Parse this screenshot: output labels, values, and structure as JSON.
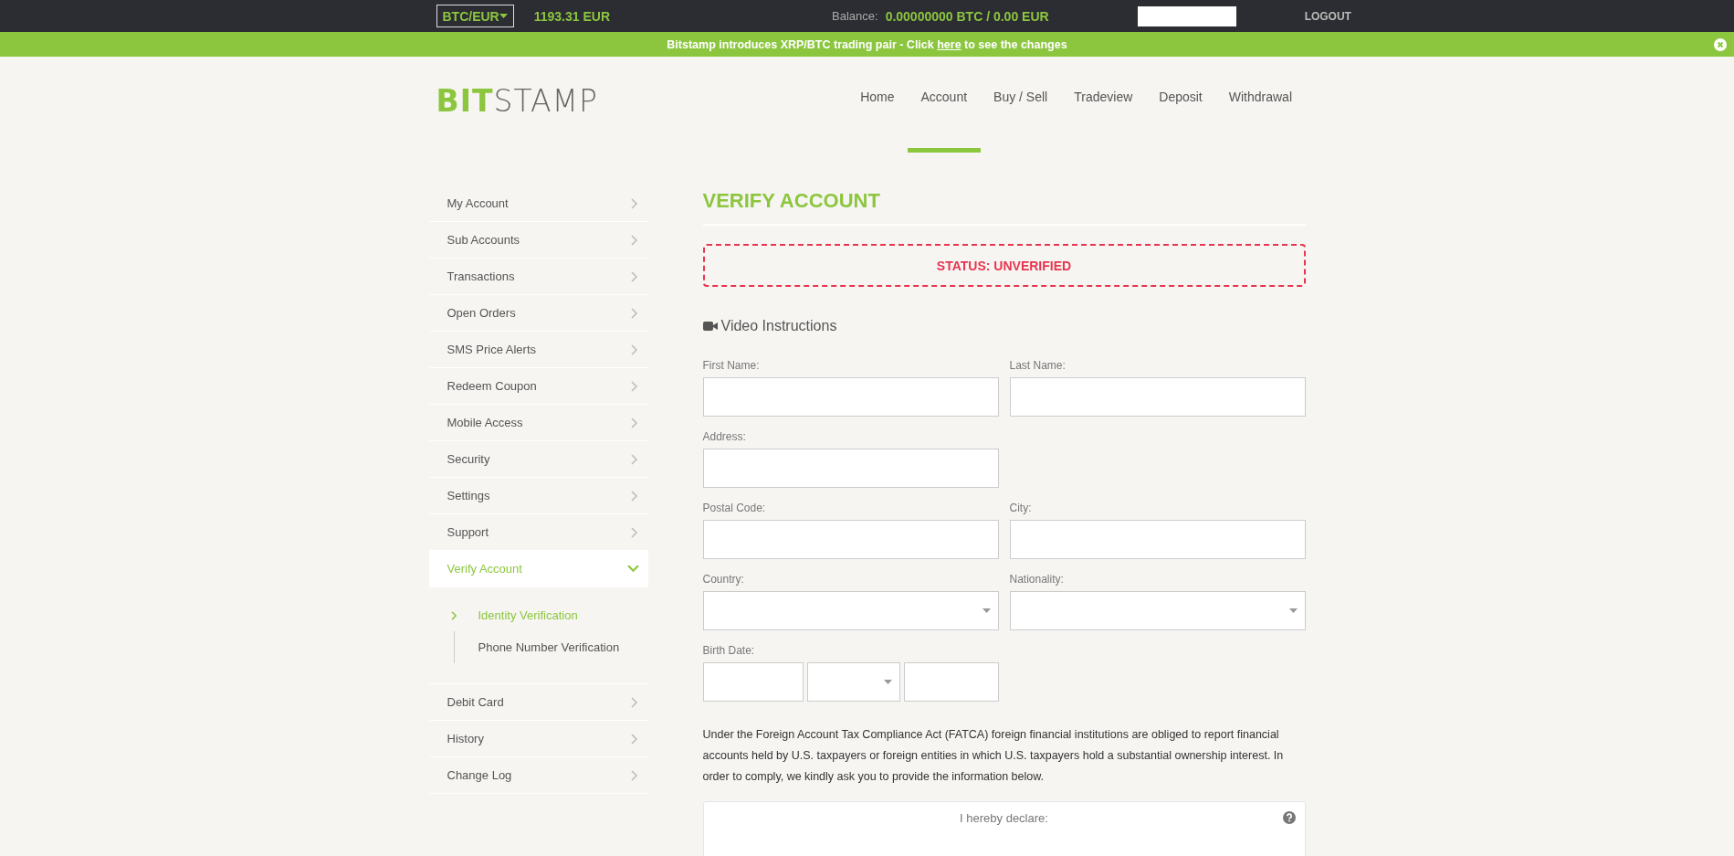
{
  "top_bar": {
    "pair_select": "BTC/EUR",
    "price": "1193.31 EUR",
    "balance_label": "Balance:",
    "balance_value": "0.00000000 BTC / 0.00 EUR",
    "logout": "LOGOUT"
  },
  "banner": {
    "before": "Bitstamp introduces XRP/BTC trading pair - Click ",
    "link": "here",
    "after": " to see the changes"
  },
  "logo": {
    "accent": "BIT",
    "rest": "STAMP"
  },
  "nav": [
    {
      "label": "Home",
      "selected": false
    },
    {
      "label": "Account",
      "selected": true
    },
    {
      "label": "Buy / Sell",
      "selected": false
    },
    {
      "label": "Tradeview",
      "selected": false
    },
    {
      "label": "Deposit",
      "selected": false
    },
    {
      "label": "Withdrawal",
      "selected": false
    }
  ],
  "sidebar": {
    "items": [
      {
        "label": "My Account",
        "selected": false,
        "expanded": false
      },
      {
        "label": "Sub Accounts",
        "selected": false,
        "expanded": false
      },
      {
        "label": "Transactions",
        "selected": false,
        "expanded": false
      },
      {
        "label": "Open Orders",
        "selected": false,
        "expanded": false
      },
      {
        "label": "SMS Price Alerts",
        "selected": false,
        "expanded": false
      },
      {
        "label": "Redeem Coupon",
        "selected": false,
        "expanded": false
      },
      {
        "label": "Mobile Access",
        "selected": false,
        "expanded": false
      },
      {
        "label": "Security",
        "selected": false,
        "expanded": false
      },
      {
        "label": "Settings",
        "selected": false,
        "expanded": false
      },
      {
        "label": "Support",
        "selected": false,
        "expanded": false
      },
      {
        "label": "Verify Account",
        "selected": true,
        "expanded": true,
        "children": [
          {
            "label": "Identity Verification",
            "selected": true
          },
          {
            "label": "Phone Number Verification",
            "selected": false
          }
        ]
      },
      {
        "label": "Debit Card",
        "selected": false,
        "expanded": false
      },
      {
        "label": "History",
        "selected": false,
        "expanded": false
      },
      {
        "label": "Change Log",
        "selected": false,
        "expanded": false
      }
    ]
  },
  "page_title": "VERIFY ACCOUNT",
  "status": "STATUS: UNVERIFIED",
  "video_link": "Video Instructions",
  "form": {
    "rows": [
      [
        {
          "label": "First Name:",
          "kind": "text"
        },
        {
          "label": "Last Name:",
          "kind": "text"
        }
      ],
      [
        {
          "label": "Address:",
          "kind": "text"
        }
      ],
      [
        {
          "label": "Postal Code:",
          "kind": "text"
        },
        {
          "label": "City:",
          "kind": "text"
        }
      ],
      [
        {
          "label": "Country:",
          "kind": "select"
        },
        {
          "label": "Nationality:",
          "kind": "select"
        }
      ],
      [
        {
          "label": "Birth Date:",
          "kind": "date",
          "parts": [
            {
              "kind": "text"
            },
            {
              "kind": "select"
            },
            {
              "kind": "text"
            }
          ]
        }
      ]
    ]
  },
  "fatca_text": "Under the Foreign Account Tax Compliance Act (FATCA) foreign financial institutions are obliged to report financial accounts held by U.S. taxpayers or foreign entities in which U.S. taxpayers hold a substantial ownership interest. In order to comply, we kindly ask you to provide the information below.",
  "declaration": {
    "title": "I hereby declare:"
  }
}
